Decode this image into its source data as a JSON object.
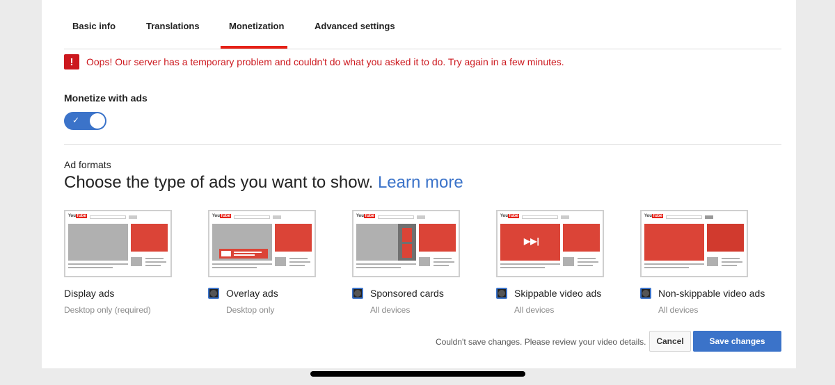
{
  "tabs": [
    {
      "label": "Basic info"
    },
    {
      "label": "Translations"
    },
    {
      "label": "Monetization"
    },
    {
      "label": "Advanced settings"
    }
  ],
  "active_tab": "Monetization",
  "error": {
    "icon": "!",
    "message": "Oops! Our server has a temporary problem and couldn't do what you asked it to do. Try again in a few minutes."
  },
  "monetize": {
    "title": "Monetize with ads",
    "toggle_on": true
  },
  "ad_formats": {
    "label": "Ad formats",
    "headline": "Choose the type of ads you want to show.",
    "learn_more": "Learn more",
    "thumb_logo": "You",
    "thumb_logo_tube": "Tube",
    "formats": [
      {
        "label": "Display ads",
        "sub": "Desktop only (required)",
        "checkbox": false
      },
      {
        "label": "Overlay ads",
        "sub": "Desktop only",
        "checkbox": true
      },
      {
        "label": "Sponsored cards",
        "sub": "All devices",
        "checkbox": true
      },
      {
        "label": "Skippable video ads",
        "sub": "All devices",
        "checkbox": true
      },
      {
        "label": "Non-skippable video ads",
        "sub": "All devices",
        "checkbox": true
      }
    ]
  },
  "footer": {
    "message": "Couldn't save changes. Please review your video details.",
    "cancel_label": "Cancel",
    "save_label": "Save changes"
  },
  "colors": {
    "accent": "#3b73c9",
    "error": "#cc181e",
    "brand_red": "#e62117"
  }
}
